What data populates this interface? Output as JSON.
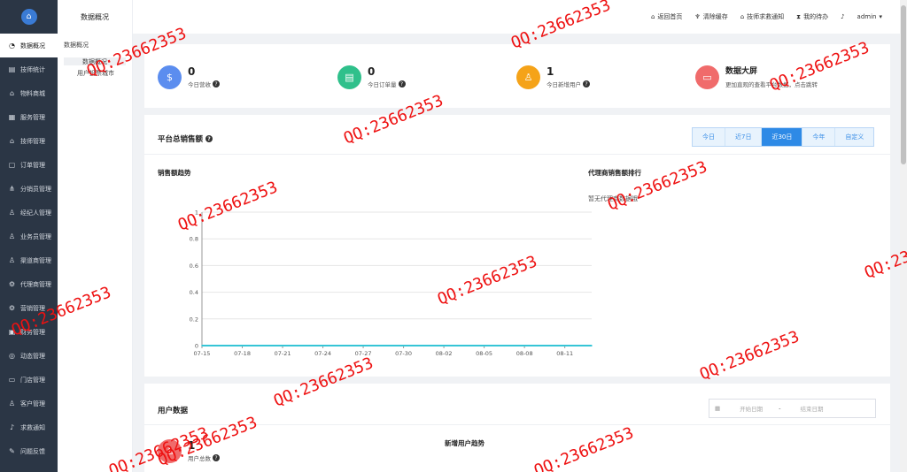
{
  "sidebar": {
    "items": [
      {
        "label": "数据概况",
        "icon": "pie-icon",
        "glyph": "◔"
      },
      {
        "label": "技师统计",
        "icon": "chart-icon",
        "glyph": "▤"
      },
      {
        "label": "物料商城",
        "icon": "shop-icon",
        "glyph": "⌂"
      },
      {
        "label": "服务管理",
        "icon": "service-icon",
        "glyph": "▦"
      },
      {
        "label": "技师管理",
        "icon": "home-icon",
        "glyph": "⌂"
      },
      {
        "label": "订单管理",
        "icon": "order-icon",
        "glyph": "▢"
      },
      {
        "label": "分销员管理",
        "icon": "share-icon",
        "glyph": "⋔"
      },
      {
        "label": "经纪人管理",
        "icon": "user-icon",
        "glyph": "♙"
      },
      {
        "label": "业务员管理",
        "icon": "group-icon",
        "glyph": "♙"
      },
      {
        "label": "渠道商管理",
        "icon": "person-icon",
        "glyph": "♙"
      },
      {
        "label": "代理商管理",
        "icon": "agent-icon",
        "glyph": "⚙"
      },
      {
        "label": "营销管理",
        "icon": "marketing-icon",
        "glyph": "⚙"
      },
      {
        "label": "财务管理",
        "icon": "finance-icon",
        "glyph": "▣"
      },
      {
        "label": "动态管理",
        "icon": "compass-icon",
        "glyph": "◎"
      },
      {
        "label": "门店管理",
        "icon": "store-icon",
        "glyph": "▭"
      },
      {
        "label": "客户管理",
        "icon": "customer-icon",
        "glyph": "♙"
      },
      {
        "label": "求救通知",
        "icon": "bell-icon",
        "glyph": "♪"
      },
      {
        "label": "问题反馈",
        "icon": "feedback-icon",
        "glyph": "✎"
      }
    ]
  },
  "subside": {
    "title": "数据概况",
    "group": "数据概况",
    "items": [
      "数据概况",
      "用户投票城市"
    ]
  },
  "header": {
    "home": "返回首页",
    "clear_cache": "清除缓存",
    "notify": "技师求救通知",
    "todo": "我的待办",
    "user": "admin"
  },
  "stats": [
    {
      "value": "0",
      "label": "今日营收",
      "color": "#5b8def",
      "icon": "money-bag-icon",
      "glyph": "$"
    },
    {
      "value": "0",
      "label": "今日订单量",
      "color": "#2fc08b",
      "icon": "clipboard-icon",
      "glyph": "▤"
    },
    {
      "value": "1",
      "label": "今日新增用户",
      "color": "#f5a319",
      "icon": "user-icon",
      "glyph": "♙"
    },
    {
      "value": "数据大屏",
      "label": "更加直观的查看平台数据，点击跳转",
      "color": "#f06b6b",
      "icon": "monitor-icon",
      "glyph": "▭"
    }
  ],
  "sales": {
    "title": "平台总销售额",
    "ranges": [
      "今日",
      "近7日",
      "近30日",
      "今年",
      "自定义"
    ],
    "active_range": "近30日",
    "trend_title": "销售额趋势",
    "agent_title": "代理商销售额排行",
    "agent_nodata": "暂无代理商数据哦"
  },
  "users": {
    "title": "用户数据",
    "start_placeholder": "开始日期",
    "end_placeholder": "结束日期",
    "total_value": "1",
    "total_label": "用户总数",
    "trend_title": "新增用户趋势"
  },
  "chart_data": {
    "type": "line",
    "title": "销售额趋势",
    "x": [
      "07-15",
      "07-16",
      "07-17",
      "07-18",
      "07-19",
      "07-20",
      "07-21",
      "07-22",
      "07-23",
      "07-24",
      "07-25",
      "07-26",
      "07-27",
      "07-28",
      "07-29",
      "07-30",
      "07-31",
      "08-01",
      "08-02",
      "08-03",
      "08-04",
      "08-05",
      "08-06",
      "08-07",
      "08-08",
      "08-09",
      "08-10",
      "08-11",
      "08-12",
      "08-13"
    ],
    "x_tick_labels": [
      "07-15",
      "07-18",
      "07-21",
      "07-24",
      "07-27",
      "07-30",
      "08-02",
      "08-05",
      "08-08",
      "08-11"
    ],
    "series": [
      {
        "values": [
          0,
          0,
          0,
          0,
          0,
          0,
          0,
          0,
          0,
          0,
          0,
          0,
          0,
          0,
          0,
          0,
          0,
          0,
          0,
          0,
          0,
          0,
          0,
          0,
          0,
          0,
          0,
          0,
          0,
          0
        ],
        "color": "#36c5d6"
      }
    ],
    "y_ticks": [
      "0",
      "0.2",
      "0.4",
      "0.6",
      "0.8",
      "1"
    ],
    "ylim": [
      0,
      1
    ],
    "grid": true
  },
  "watermark": "QQ:23662353"
}
